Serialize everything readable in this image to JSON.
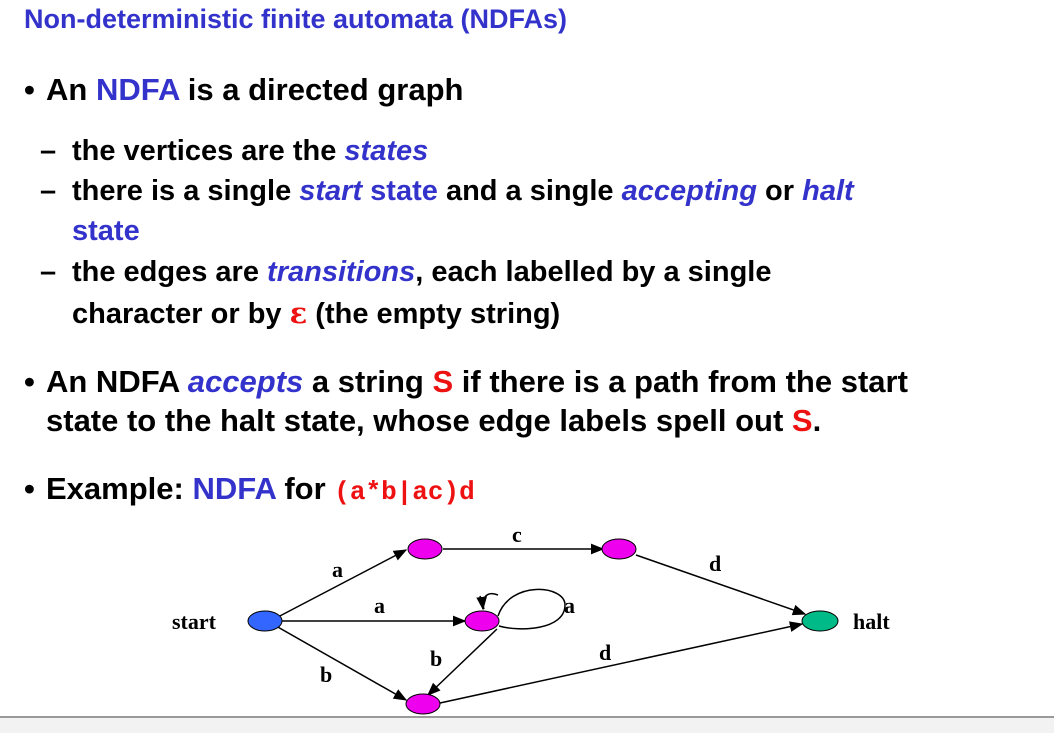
{
  "title": "Non-deterministic finite automata (NDFAs)",
  "bullet1": {
    "t1": "An ",
    "t2": "NDFA",
    "t3": " is a directed graph"
  },
  "sub1": {
    "t1": "the vertices are the ",
    "t2": "states"
  },
  "sub2": {
    "t1": "there is a single ",
    "t2": "start",
    "t3": " state",
    "t4": " and a single ",
    "t5": "accepting",
    "t6": " or ",
    "t7": "halt",
    "t8": "state"
  },
  "sub3": {
    "t1": "the edges are ",
    "t2": "transitions",
    "t3": ", each labelled by a single",
    "t4": "character or by ",
    "t5": "ε",
    "t6": " (the empty string)"
  },
  "bullet2": {
    "t1": "An NDFA ",
    "t2": "accepts",
    "t3": " a string ",
    "t4": "S",
    "t5": " if there is a path from the start",
    "t6": "state to the halt state, whose edge labels spell out ",
    "t7": "S",
    "t8": "."
  },
  "bullet3": {
    "t1": "Example:  ",
    "t2": "NDFA",
    "t3": " for ",
    "t4": "(a*b|ac)d"
  },
  "diagram": {
    "start_label": "start",
    "halt_label": "halt",
    "edge_labels": {
      "start_to_top": "a",
      "start_to_mid": "a",
      "start_to_bottom": "b",
      "top_to_topright": "c",
      "topright_to_halt": "d",
      "mid_loop": "a",
      "mid_to_bottom": "b",
      "bottom_to_halt": "d"
    },
    "colors": {
      "start_node": "#3366ff",
      "intermediate_node": "#ee00ee",
      "halt_node": "#00bb88",
      "edge": "#000000"
    }
  },
  "colors": {
    "accent_blue": "#3333cc",
    "accent_red": "#ee1111"
  }
}
